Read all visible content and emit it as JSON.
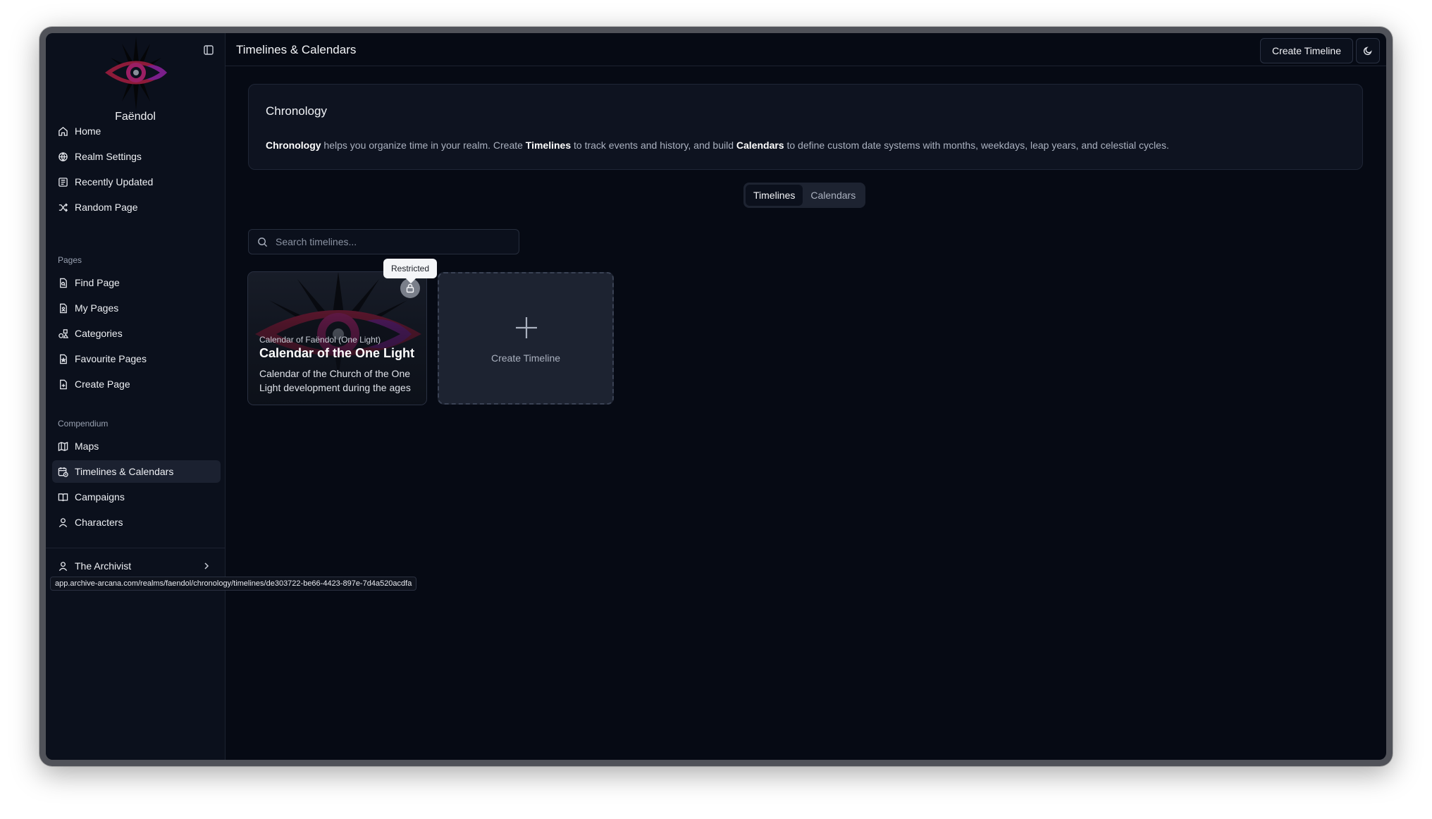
{
  "app": {
    "realm_name": "Faëndol",
    "page_title": "Timelines & Calendars"
  },
  "sidebar": {
    "main_items": [
      {
        "label": "Home",
        "icon": "home-icon"
      },
      {
        "label": "Realm Settings",
        "icon": "globe-settings-icon"
      },
      {
        "label": "Recently Updated",
        "icon": "newspaper-icon"
      },
      {
        "label": "Random Page",
        "icon": "shuffle-icon"
      }
    ],
    "pages_label": "Pages",
    "pages_items": [
      {
        "label": "Find Page",
        "icon": "file-search-icon"
      },
      {
        "label": "My Pages",
        "icon": "file-user-icon"
      },
      {
        "label": "Categories",
        "icon": "shapes-icon"
      },
      {
        "label": "Favourite Pages",
        "icon": "file-star-icon"
      },
      {
        "label": "Create Page",
        "icon": "file-plus-icon"
      }
    ],
    "compendium_label": "Compendium",
    "compendium_items": [
      {
        "label": "Maps",
        "icon": "map-icon"
      },
      {
        "label": "Timelines & Calendars",
        "icon": "calendar-clock-icon",
        "active": true
      },
      {
        "label": "Campaigns",
        "icon": "book-open-icon"
      },
      {
        "label": "Characters",
        "icon": "user-icon"
      }
    ],
    "user_name": "The Archivist"
  },
  "header": {
    "create_button": "Create Timeline"
  },
  "info": {
    "title": "Chronology",
    "text_bold_1": "Chronology",
    "text_1": " helps you organize time in your realm. Create ",
    "text_bold_2": "Timelines",
    "text_2": " to track events and history, and build ",
    "text_bold_3": "Calendars",
    "text_3": " to define custom date systems with months, weekdays, leap years, and celestial cycles."
  },
  "tabs": [
    {
      "label": "Timelines",
      "active": true
    },
    {
      "label": "Calendars",
      "active": false
    }
  ],
  "search": {
    "placeholder": "Search timelines...",
    "value": ""
  },
  "timeline_card": {
    "subtitle": "Calendar of Faëndol (One Light)",
    "title": "Calendar of the One Light",
    "description": "Calendar of the Church of the One Light development during the ages",
    "tooltip": "Restricted"
  },
  "create_card": {
    "label": "Create Timeline"
  },
  "status_url": "app.archive-arcana.com/realms/faendol/chronology/timelines/de303722-be66-4423-897e-7d4a520acdfa",
  "colors": {
    "background": "#060a14",
    "sidebar": "#0b101c",
    "accent_crimson": "#8e1b3a",
    "accent_purple": "#7a1f8a"
  }
}
